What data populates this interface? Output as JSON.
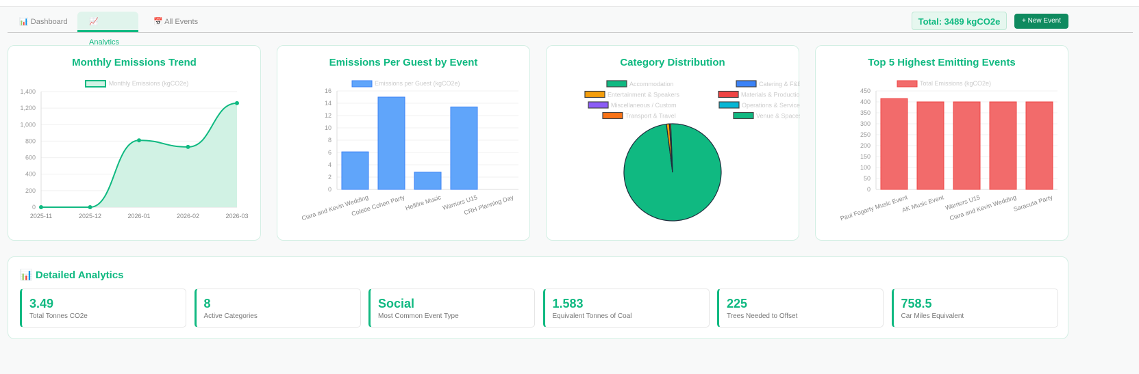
{
  "tabs": [
    {
      "icon": "📊",
      "label": "Dashboard"
    },
    {
      "icon": "📈",
      "label": "Analytics"
    },
    {
      "icon": "📅",
      "label": "All Events"
    }
  ],
  "header": {
    "total": "Total: 3489 kgCO2e",
    "new_event": "+ New Event"
  },
  "colors": {
    "accent": "#10b981",
    "bar_blue": "#60a5fa",
    "bar_red": "#f26b6b"
  },
  "chart_data": [
    {
      "type": "area",
      "title": "Monthly Emissions Trend",
      "legend": "Monthly Emissions (kgCO2e)",
      "categories": [
        "2025-11",
        "2025-12",
        "2026-01",
        "2026-02",
        "2026-03"
      ],
      "values": [
        0,
        0,
        810,
        730,
        1260
      ],
      "ylim": [
        0,
        1400
      ],
      "yticks": [
        "0",
        "200",
        "400",
        "600",
        "800",
        "1,000",
        "1,200",
        "1,400"
      ]
    },
    {
      "type": "bar",
      "title": "Emissions Per Guest by Event",
      "legend": "Emissions per Guest (kgCO2e)",
      "categories": [
        "Ciara and Kevin Wedding",
        "Colette Cohen Party",
        "Hellfire Music",
        "Warriors U15",
        "CRH Planning Day"
      ],
      "values": [
        6.1,
        15,
        2.8,
        13.4,
        0
      ],
      "ylim": [
        0,
        16
      ],
      "yticks": [
        "0",
        "2",
        "4",
        "6",
        "8",
        "10",
        "12",
        "14",
        "16"
      ]
    },
    {
      "type": "pie",
      "title": "Category Distribution",
      "legend": [
        {
          "name": "Accommodation",
          "color": "#10b981"
        },
        {
          "name": "Catering & F&B",
          "color": "#3b82f6"
        },
        {
          "name": "Entertainment & Speakers",
          "color": "#f59e0b"
        },
        {
          "name": "Materials & Production",
          "color": "#ef4444"
        },
        {
          "name": "Miscellaneous / Custom",
          "color": "#8b5cf6"
        },
        {
          "name": "Operations & Services",
          "color": "#06b6d4"
        },
        {
          "name": "Transport & Travel",
          "color": "#f97316"
        },
        {
          "name": "Venue & Spaces",
          "color": "#10b981"
        }
      ],
      "values": [
        98.6,
        0,
        1.0,
        0,
        0,
        0,
        0.4,
        0
      ]
    },
    {
      "type": "bar",
      "title": "Top 5 Highest Emitting Events",
      "legend": "Total Emissions (kgCO2e)",
      "categories": [
        "Paul Fogarty Music Event",
        "AK Music Event",
        "Warriors U15",
        "Ciara and Kevin Wedding",
        "Saracuta Party"
      ],
      "values": [
        415,
        400,
        400,
        400,
        400
      ],
      "ylim": [
        0,
        450
      ],
      "yticks": [
        "0",
        "50",
        "100",
        "150",
        "200",
        "250",
        "300",
        "350",
        "400",
        "450"
      ]
    }
  ],
  "details": {
    "icon": "📊",
    "title": "Detailed Analytics",
    "stats": [
      {
        "value": "3.49",
        "label": "Total Tonnes CO2e"
      },
      {
        "value": "8",
        "label": "Active Categories"
      },
      {
        "value": "Social",
        "label": "Most Common Event Type"
      },
      {
        "value": "1.583",
        "label": "Equivalent Tonnes of Coal"
      },
      {
        "value": "225",
        "label": "Trees Needed to Offset"
      },
      {
        "value": "758.5",
        "label": "Car Miles Equivalent"
      }
    ]
  }
}
